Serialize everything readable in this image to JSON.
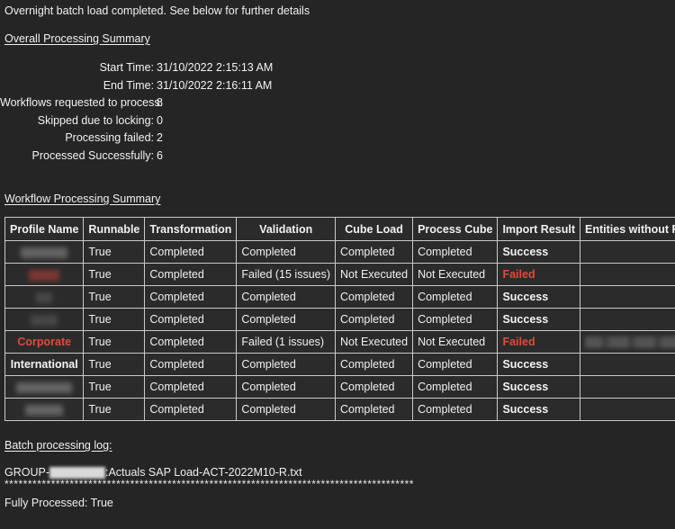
{
  "intro": "Overnight batch load completed. See below for further details",
  "overall": {
    "heading": "Overall Processing Summary",
    "rows": [
      {
        "label": "Start Time:",
        "value": "31/10/2022 2:15:13 AM"
      },
      {
        "label": "End Time:",
        "value": "31/10/2022 2:16:11 AM"
      },
      {
        "label": "Workflows requested to process:",
        "value": "8"
      },
      {
        "label": "Skipped due to locking:",
        "value": "0"
      },
      {
        "label": "Processing failed:",
        "value": "2"
      },
      {
        "label": "Processed Successfully:",
        "value": "6"
      }
    ]
  },
  "workflow": {
    "heading": "Workflow Processing Summary",
    "columns": [
      "Profile Name",
      "Runnable",
      "Transformation",
      "Validation",
      "Cube Load",
      "Process Cube",
      "Import Result",
      "Entities without Files:"
    ],
    "rows": [
      {
        "profile": "",
        "profile_redacted": true,
        "profile_redact_style": "gray",
        "profile_redact_width": 52,
        "runnable": "True",
        "transformation": "Completed",
        "validation": "Completed",
        "cube_load": "Completed",
        "process_cube": "Completed",
        "import_result": "Success",
        "import_result_color": "#f4f4f4",
        "entities": "",
        "entities_redacted": false
      },
      {
        "profile": "",
        "profile_redacted": true,
        "profile_redact_style": "red",
        "profile_redact_width": 34,
        "runnable": "True",
        "transformation": "Completed",
        "validation": "Failed (15 issues)",
        "cube_load": "Not Executed",
        "process_cube": "Not Executed",
        "import_result": "Failed",
        "import_result_color": "#e04a3c",
        "entities": "",
        "entities_redacted": false
      },
      {
        "profile": "",
        "profile_redacted": true,
        "profile_redact_style": "faint",
        "profile_redact_width": 18,
        "runnable": "True",
        "transformation": "Completed",
        "validation": "Completed",
        "cube_load": "Completed",
        "process_cube": "Completed",
        "import_result": "Success",
        "import_result_color": "#f4f4f4",
        "entities": "",
        "entities_redacted": false
      },
      {
        "profile": "",
        "profile_redacted": true,
        "profile_redact_style": "faint",
        "profile_redact_width": 30,
        "runnable": "True",
        "transformation": "Completed",
        "validation": "Completed",
        "cube_load": "Completed",
        "process_cube": "Completed",
        "import_result": "Success",
        "import_result_color": "#f4f4f4",
        "entities": "",
        "entities_redacted": false
      },
      {
        "profile": "Corporate",
        "profile_redacted": false,
        "profile_color": "#e04a3c",
        "runnable": "True",
        "transformation": "Completed",
        "validation": "Failed (1 issues)",
        "cube_load": "Not Executed",
        "process_cube": "Not Executed",
        "import_result": "Failed",
        "import_result_color": "#e04a3c",
        "entities": "",
        "entities_redacted": true
      },
      {
        "profile": "International",
        "profile_redacted": false,
        "profile_color": "#f4f4f4",
        "runnable": "True",
        "transformation": "Completed",
        "validation": "Completed",
        "cube_load": "Completed",
        "process_cube": "Completed",
        "import_result": "Success",
        "import_result_color": "#f4f4f4",
        "entities": "",
        "entities_redacted": false
      },
      {
        "profile": "",
        "profile_redacted": true,
        "profile_redact_style": "gray",
        "profile_redact_width": 62,
        "runnable": "True",
        "transformation": "Completed",
        "validation": "Completed",
        "cube_load": "Completed",
        "process_cube": "Completed",
        "import_result": "Success",
        "import_result_color": "#f4f4f4",
        "entities": "",
        "entities_redacted": false
      },
      {
        "profile": "",
        "profile_redacted": true,
        "profile_redact_style": "gray",
        "profile_redact_width": 42,
        "runnable": "True",
        "transformation": "Completed",
        "validation": "Completed",
        "cube_load": "Completed",
        "process_cube": "Completed",
        "import_result": "Success",
        "import_result_color": "#f4f4f4",
        "entities": "",
        "entities_redacted": false
      }
    ]
  },
  "log": {
    "heading": "Batch processing log:",
    "file_prefix": "GROUP-",
    "file_suffix": ":Actuals SAP Load-ACT-2022M10-R.txt",
    "separator": "****************************************************************************************",
    "fully_processed": "Fully Processed: True"
  },
  "colors": {
    "page_bg": "#252525",
    "cell_bg": "#2b2b2b",
    "border": "#c9c9c9",
    "text": "#f0f0f0",
    "error_red": "#e04a3c"
  }
}
